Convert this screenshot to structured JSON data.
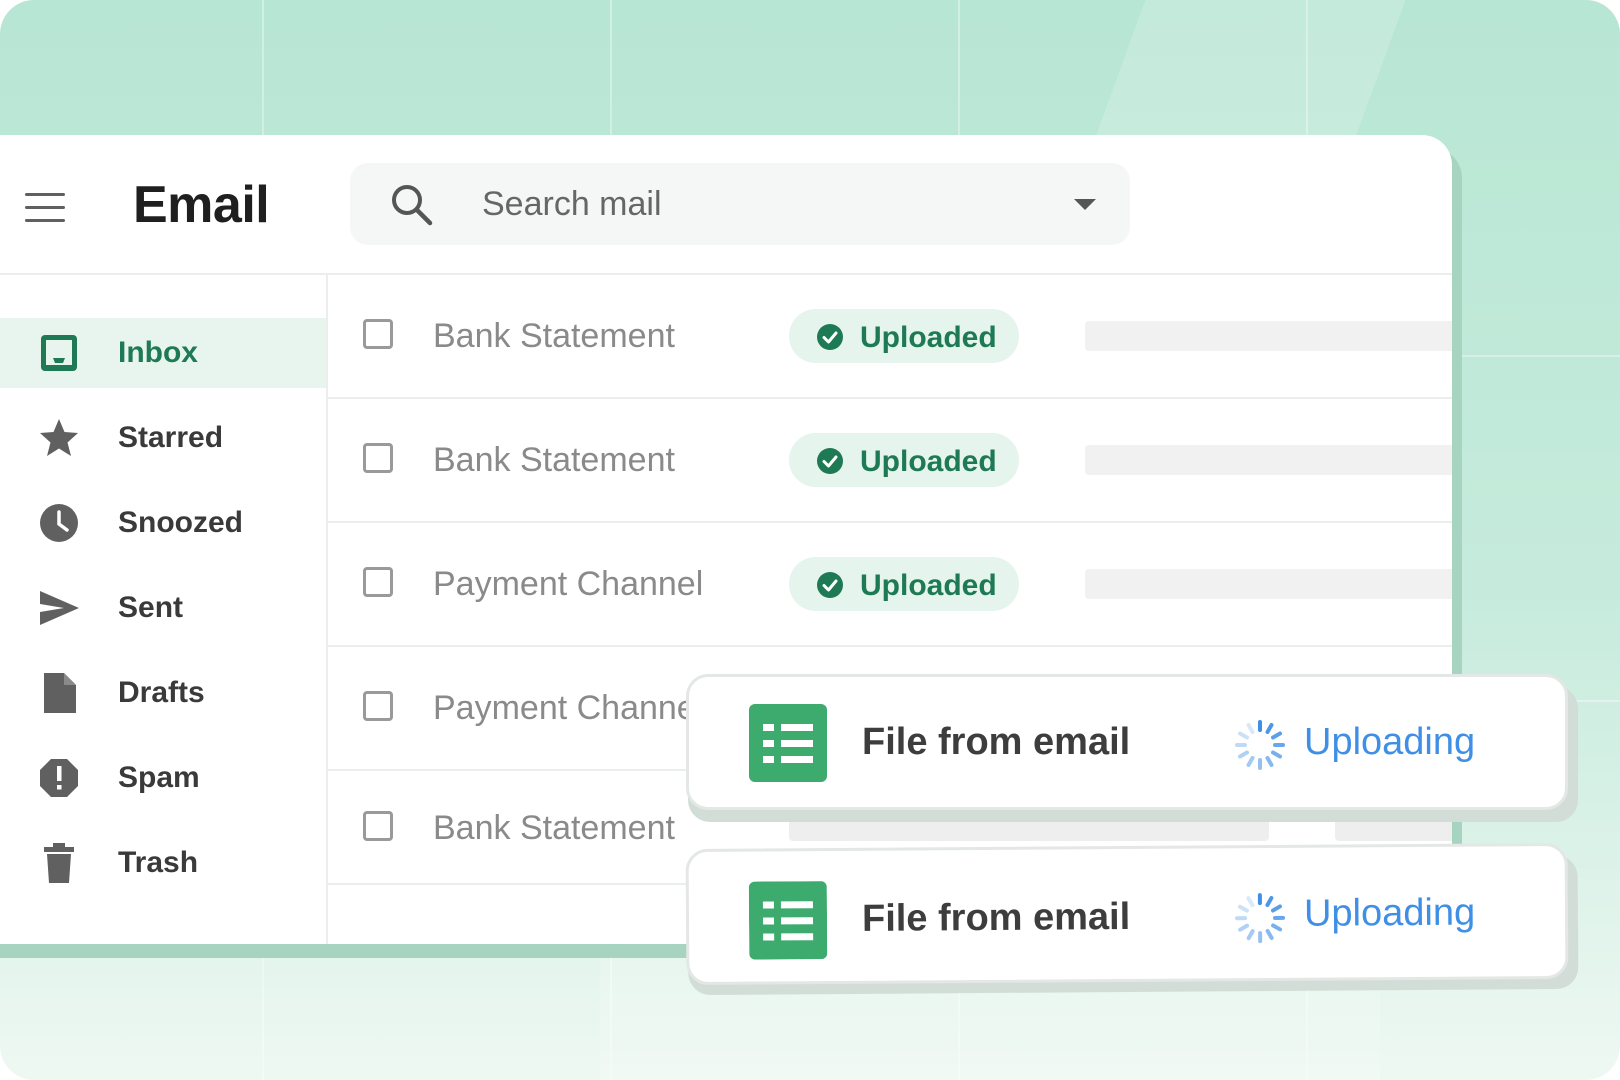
{
  "app": {
    "title": "Email"
  },
  "search": {
    "placeholder": "Search mail"
  },
  "sidebar": {
    "items": [
      {
        "label": "Inbox",
        "icon": "inbox-icon",
        "active": true
      },
      {
        "label": "Starred",
        "icon": "star-icon"
      },
      {
        "label": "Snoozed",
        "icon": "clock-icon"
      },
      {
        "label": "Sent",
        "icon": "send-icon"
      },
      {
        "label": "Drafts",
        "icon": "file-icon"
      },
      {
        "label": "Spam",
        "icon": "alert-octagon-icon"
      },
      {
        "label": "Trash",
        "icon": "trash-icon"
      }
    ]
  },
  "emails": [
    {
      "subject": "Bank Statement",
      "status": "Uploaded"
    },
    {
      "subject": "Bank Statement",
      "status": "Uploaded"
    },
    {
      "subject": "Payment Channel",
      "status": "Uploaded"
    },
    {
      "subject": "Payment Channel",
      "status": ""
    },
    {
      "subject": "Bank Statement",
      "status": ""
    }
  ],
  "uploads": [
    {
      "title": "File from email",
      "status": "Uploading",
      "icon": "spreadsheet-icon"
    },
    {
      "title": "File from email",
      "status": "Uploading",
      "icon": "spreadsheet-icon"
    }
  ],
  "colors": {
    "accent": "#1e7a55",
    "uploaded_pill": "#e5f4ec",
    "uploading_text": "#3f8fe6",
    "sheet_green": "#3daa6e",
    "background": "#b8e6d4"
  }
}
